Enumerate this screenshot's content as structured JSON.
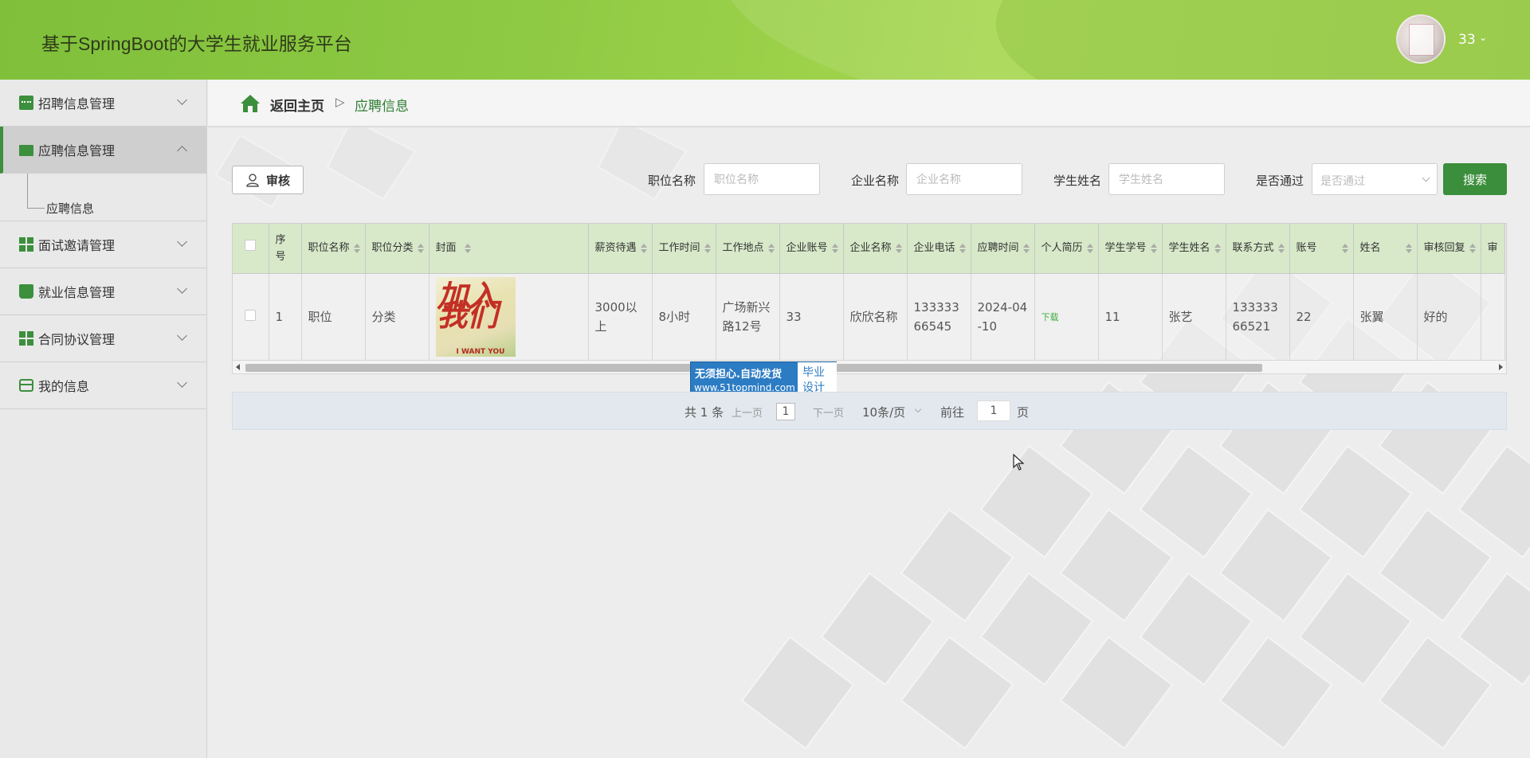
{
  "header": {
    "title": "基于SpringBoot的大学生就业服务平台",
    "username": "33"
  },
  "sidebar": {
    "items": [
      {
        "label": "招聘信息管理",
        "icon": "chat-icon"
      },
      {
        "label": "应聘信息管理",
        "icon": "monitor-icon",
        "active": true,
        "sub": "应聘信息"
      },
      {
        "label": "面试邀请管理",
        "icon": "grid-icon"
      },
      {
        "label": "就业信息管理",
        "icon": "book-icon"
      },
      {
        "label": "合同协议管理",
        "icon": "grid-icon"
      },
      {
        "label": "我的信息",
        "icon": "card-icon"
      }
    ]
  },
  "breadcrumb": {
    "home": "返回主页",
    "separator": "▷",
    "current": "应聘信息"
  },
  "toolbar": {
    "audit_label": "审核",
    "search_label": "搜索",
    "fields": [
      {
        "label": "职位名称",
        "placeholder": "职位名称"
      },
      {
        "label": "企业名称",
        "placeholder": "企业名称"
      },
      {
        "label": "学生姓名",
        "placeholder": "学生姓名"
      },
      {
        "label": "是否通过",
        "placeholder": "是否通过"
      }
    ]
  },
  "table": {
    "headers": [
      "序号",
      "职位名称",
      "职位分类",
      "封面",
      "薪资待遇",
      "工作时间",
      "工作地点",
      "企业账号",
      "企业名称",
      "企业电话",
      "应聘时间",
      "个人简历",
      "学生学号",
      "学生姓名",
      "联系方式",
      "账号",
      "姓名",
      "审核回复",
      "审"
    ],
    "rows": [
      {
        "index": "1",
        "job_name": "职位",
        "job_category": "分类",
        "cover_text": "加入我们",
        "cover_sub": "I WANT YOU",
        "salary": "3000以上",
        "work_time": "8小时",
        "location": "广场新兴路12号",
        "company_account": "33",
        "company_name": "欣欣名称",
        "company_phone": "13333366545",
        "apply_time": "2024-04-10",
        "resume": "下载",
        "student_no": "11",
        "student_name": "张艺",
        "contact": "13333366521",
        "account": "22",
        "name": "张翼",
        "reply": "好的"
      }
    ]
  },
  "watermark": {
    "line1": "无须担心.自动发货",
    "line2": "www.51topmind.com",
    "box1": "毕业",
    "box2": "设计"
  },
  "pager": {
    "total": "共 1 条",
    "prev": "上一页",
    "page": "1",
    "next": "下一页",
    "size": "10条/页",
    "goto": "前往",
    "goto_value": "1",
    "page_word": "页"
  },
  "colors": {
    "accent": "#3b8e3b",
    "header_green": "#8fca44",
    "table_header_bg": "#d7e9c9"
  }
}
